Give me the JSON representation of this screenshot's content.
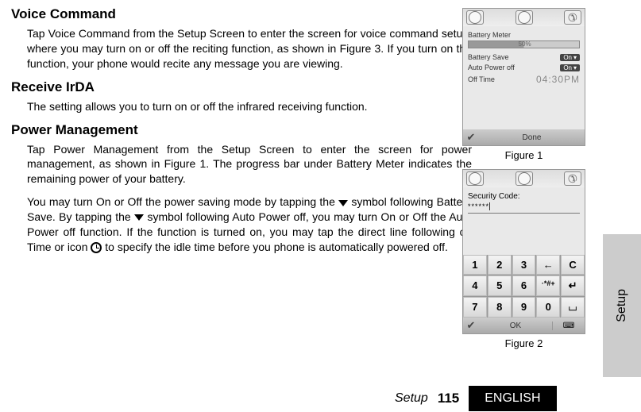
{
  "sections": {
    "voice": {
      "heading": "Voice Command",
      "para": "Tap Voice Command from the Setup Screen to enter the screen for voice command setup, where you may turn on or off the reciting function, as shown in Figure 3. If you turn on the function, your phone would recite any message you are viewing."
    },
    "irda": {
      "heading": "Receive IrDA",
      "para": "The setting allows you to turn on or off the infrared receiving function."
    },
    "power": {
      "heading": "Power Management",
      "para1": "Tap Power Management from the Setup Screen to enter the screen for power management, as shown in Figure 1. The progress bar under Battery Meter indicates the remaining power of your battery.",
      "para2a": "You may turn On or Off the power saving mode by tapping the ",
      "para2b": " symbol following Battery Save. By tapping the ",
      "para2c": " symbol following Auto Power off, you may turn On or Off the Auto Power off function. If the function is turned on, you may tap the direct line following off Time or icon ",
      "para2d": " to specify the idle time before you phone is automatically powered off."
    }
  },
  "fig1": {
    "caption": "Figure 1",
    "title": "Battery Meter",
    "percent": "50%",
    "row1_label": "Battery Save",
    "row1_value": "On",
    "row2_label": "Auto Power off",
    "row2_value": "On",
    "row3_label": "Off Time",
    "row3_value": "04:30PM",
    "done": "Done"
  },
  "fig2": {
    "caption": "Figure 2",
    "label": "Security Code:",
    "masked": "******",
    "keys": [
      "1",
      "2",
      "3",
      "←",
      "C",
      "4",
      "5",
      "6",
      "·*#+",
      "↵",
      "7",
      "8",
      "9",
      "0",
      "⌴"
    ],
    "ok": "OK"
  },
  "side_tab": "Setup",
  "footer": {
    "section": "Setup",
    "page": "115",
    "lang": "ENGLISH"
  }
}
